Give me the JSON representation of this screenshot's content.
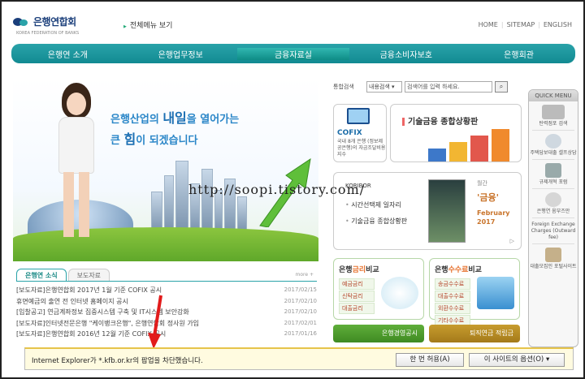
{
  "header": {
    "logo_text": "은행연합회",
    "logo_sub": "KOREA FEDERATION OF BANKS",
    "all_menu": "전체메뉴 보기",
    "links": [
      "HOME",
      "SITEMAP",
      "ENGLISH"
    ]
  },
  "gnb": [
    "은행연 소개",
    "은행업무정보",
    "금융자료실",
    "금융소비자보호",
    "은행회관"
  ],
  "hero": {
    "line1_pre": "은행산업의 ",
    "line1_big": "내일",
    "line1_post": "을 열어가는",
    "line2_pre": "큰 ",
    "line2_big": "힘",
    "line2_post": "이 되겠습니다"
  },
  "news": {
    "tabs": [
      "은행연 소식",
      "보도자료"
    ],
    "more": "more",
    "items": [
      {
        "title": "[보도자료]은행연합회 2017년 1월 기준 COFIX 공시",
        "date": "2017/02/15"
      },
      {
        "title": "휴면예금의 출연 전 인터넷 홈페이지 공시",
        "date": "2017/02/10"
      },
      {
        "title": "[입찰공고] 연금계좌정보 집중시스템 구축 및 IT시스템 보안강화",
        "date": "2017/02/10"
      },
      {
        "title": "[보도자료]인터넷전문은행 \"케이뱅크은행\", 은행연합회 정사원 가입",
        "date": "2017/02/01"
      },
      {
        "title": "[보도자료]은행연합회 2016년 12월 기준 COFIX 공시",
        "date": "2017/01/16"
      }
    ]
  },
  "search": {
    "label": "통합검색",
    "select": "내용검색",
    "placeholder": "검색어를 입력 하세요."
  },
  "cofix": {
    "title": "COFIX",
    "desc": "국내 8개 은행 (정보제공은행)의 자금조달비용지수"
  },
  "tech": {
    "title": "기술금융 종합상황판"
  },
  "kori": {
    "logo": "KORIBOR",
    "items": [
      "시간선택제 일자리",
      "기술금융 종합상황판"
    ],
    "mag_caption": "월간",
    "mag_title": "'금융'",
    "mag_month": "February",
    "mag_year": "2017",
    "more": "▷"
  },
  "rates": [
    {
      "title_hl": "금리",
      "title_pre": "은행",
      "title_post": "비교",
      "rows": [
        "예금금리",
        "신탁금리",
        "대출금리"
      ],
      "accent": "#e7722f"
    },
    {
      "title_hl": "수수료",
      "title_pre": "은행",
      "title_post": "비교",
      "rows": [
        "송금수수료",
        "대출수수료",
        "외환수수료",
        "기타수수료"
      ],
      "accent": "#e7722f"
    }
  ],
  "bottom_buttons": [
    "은행경영공시",
    "퇴직연금 적립금"
  ],
  "quick": {
    "title": "QUICK MENU",
    "items": [
      "탄력점포 검색",
      "주택담보대출 셀프상담",
      "규제개혁 포럼",
      "은행연 옴부즈만",
      "Foreign Exchange Charges (Outward fee)",
      "대출모집인 포털사이트"
    ]
  },
  "watermark": "http://soopi.tistory.com/",
  "popup": {
    "message": "Internet Explorer가 *.kfb.or.kr의 팝업을 차단했습니다.",
    "allow": "한 번 허용(A)",
    "options": "이 사이트의 옵션(O) ▾"
  }
}
